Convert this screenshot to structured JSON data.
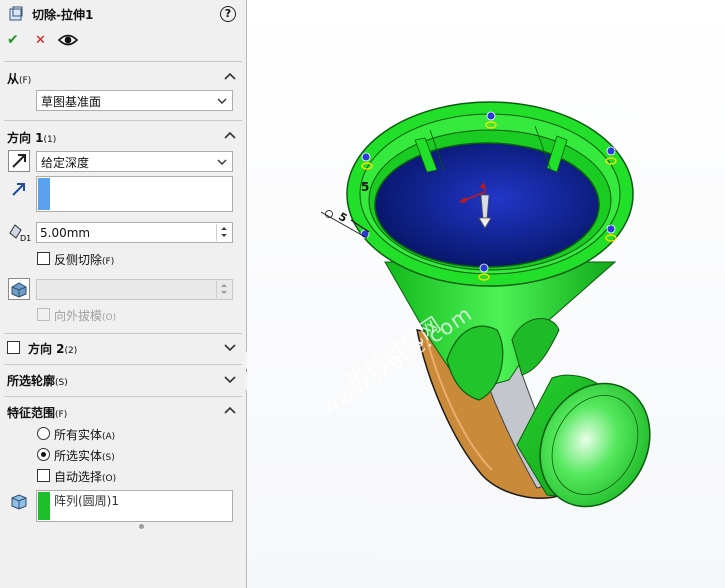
{
  "header": {
    "title": "切除-拉伸1",
    "help": "?"
  },
  "actions": {
    "ok": "✔",
    "cancel": "✕"
  },
  "from": {
    "label": "从",
    "suffix": "(F)",
    "value": "草图基准面"
  },
  "direction1": {
    "label": "方向 1",
    "suffix": "(1)",
    "end_condition": "给定深度",
    "depth": "5.00mm",
    "flip_side_label": "反侧切除",
    "flip_side_suffix": "(F)",
    "draft_label": "向外拔模",
    "draft_suffix": "(O)"
  },
  "direction2": {
    "label": "方向 2",
    "suffix": "(2)"
  },
  "selected_contours": {
    "label": "所选轮廓",
    "suffix": "(S)"
  },
  "feature_scope": {
    "label": "特征范围",
    "suffix": "(F)",
    "all_bodies": "所有实体",
    "all_bodies_suffix": "(A)",
    "selected_bodies": "所选实体",
    "selected_bodies_suffix": "(S)",
    "auto_select": "自动选择",
    "auto_select_suffix": "(O)",
    "selected_item": "阵列(圆周)1"
  },
  "viewport": {
    "dimension_text": "5",
    "watermark_line1": "机械时代网",
    "watermark_line2": "www.jxace.com"
  },
  "colors": {
    "model_green": "#22e02a",
    "cut_face_blue": "#0a1f9e",
    "body_orange": "#c98a3a",
    "list_highlight_blue": "#5aa2f0",
    "list_highlight_green": "#1dbf2a"
  }
}
